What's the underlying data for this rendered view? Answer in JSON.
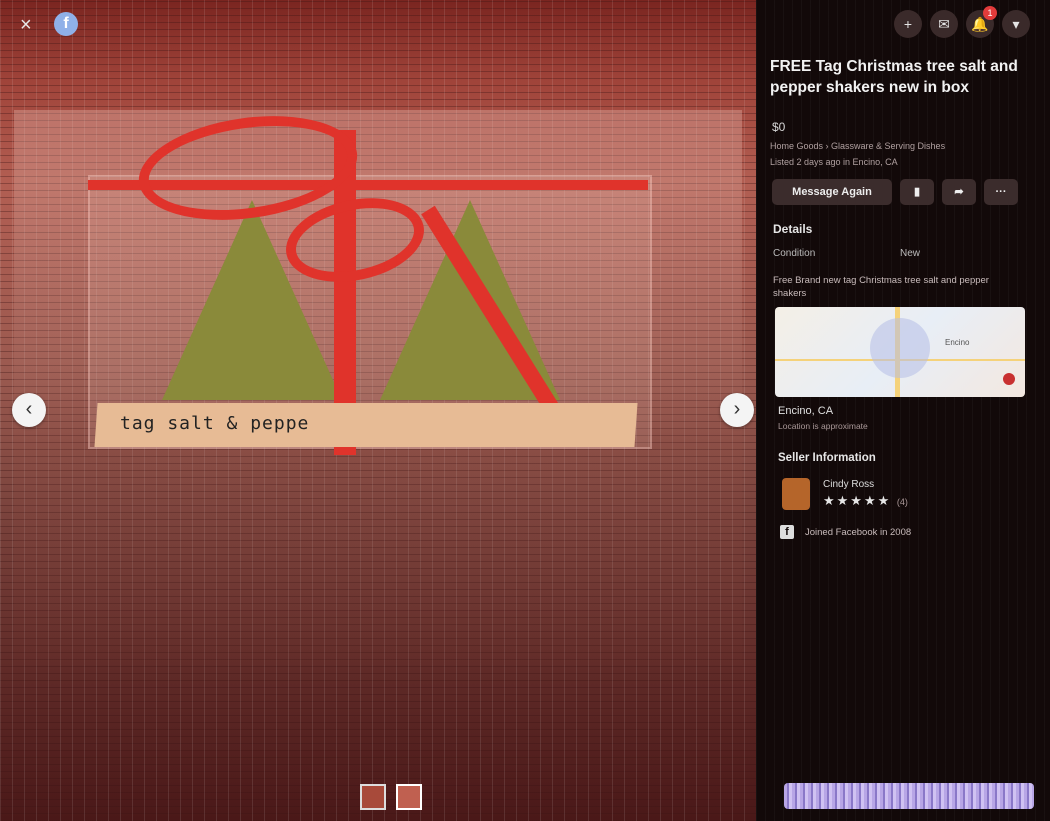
{
  "viewer": {
    "close_label": "×",
    "logo_letter": "f",
    "prev_label": "‹",
    "next_label": "›",
    "box_label_text": "tag salt & peppe"
  },
  "topbar": {
    "icons": [
      {
        "name": "plus-icon",
        "glyph": "+"
      },
      {
        "name": "messenger-icon",
        "glyph": "✉"
      },
      {
        "name": "bell-icon",
        "glyph": "🔔"
      },
      {
        "name": "account-menu-icon",
        "glyph": "▾"
      }
    ],
    "notification_count": "1"
  },
  "listing": {
    "title": "FREE Tag Christmas tree salt and pepper shakers new in box",
    "price": "$0",
    "breadcrumbs": "Home Goods › Glassware & Serving Dishes",
    "listed": "Listed 2 days ago in Encino, CA"
  },
  "actions": {
    "message_label": "Message Again",
    "save_glyph": "▮",
    "share_glyph": "➦",
    "more_glyph": "···"
  },
  "details": {
    "heading": "Details",
    "condition_label": "Condition",
    "condition_value": "New",
    "description": "Free Brand new tag Christmas tree salt and pepper shakers"
  },
  "map": {
    "label": "Encino"
  },
  "location": {
    "city": "Encino, CA",
    "sub": "Location is approximate"
  },
  "seller": {
    "heading": "Seller Information",
    "name": "Cindy Ross",
    "stars": "★★★★★",
    "rating_count": "(4)",
    "joined": "Joined Facebook in 2008"
  },
  "colors": {
    "ribbon": "#e0332b",
    "panel_bg": "#120909",
    "button_bg": "#3b2c2c"
  }
}
